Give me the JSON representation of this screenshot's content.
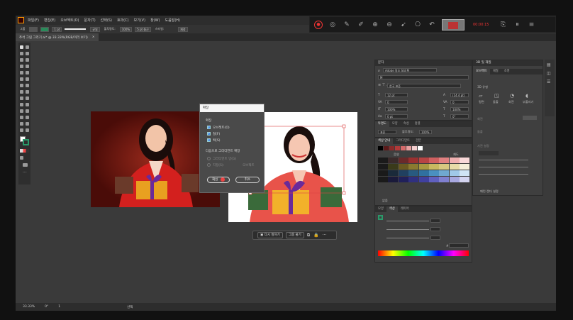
{
  "menu": [
    "파일(F)",
    "편집(E)",
    "오브젝트(O)",
    "문자(T)",
    "선택(S)",
    "효과(C)",
    "보기(V)",
    "창(W)",
    "도움말(H)"
  ],
  "control": {
    "group_label": "그룹",
    "stroke_size": "1 pt",
    "stroke_style": "균일",
    "opacity_label": "불투명도:",
    "opacity_value": "100%",
    "style_label": "스타일:",
    "arrange_label": "재정",
    "ratio": "5 pt 둥근"
  },
  "recorder": {
    "timer": "00:00:15"
  },
  "tab": {
    "title": "추석 그림 그리기.ai* @ 33.33%(RGB/미리 보기)",
    "close": "×"
  },
  "dialog": {
    "title": "확장",
    "section": "확장",
    "options": [
      "오브젝트(O)",
      "칠(F)",
      "획(S)"
    ],
    "gradient_label": "다음으로 그라디언트 확장",
    "gradient_options": [
      "그라디언트 망(G)",
      "지정(S):",
      "오브젝트"
    ],
    "ok": "확인",
    "cancel": "취소"
  },
  "context": {
    "regenerate": "다시 칠하기",
    "group": "그룹 풀기"
  },
  "panels": {
    "char": {
      "title": "문자",
      "font": "Adobe 명조 Std M",
      "style": "M",
      "size": "12 pt",
      "leading": "(14.4 pt)",
      "kerning": "0",
      "tracking": "0",
      "scale_v": "100%",
      "scale_h": "100%",
      "baseline": "0 pt",
      "rotate": "0°",
      "lang": "한국 표준"
    },
    "transparency": {
      "tabs": [
        "투명도",
        "모양",
        "속성",
        "정렬"
      ],
      "mode": "표준",
      "opacity_label": "불투명도:",
      "opacity": "100%"
    },
    "swatch_guide": {
      "tabs": [
        "색상 안내",
        "그라디언트",
        "견본"
      ],
      "left": "음영",
      "right": "채도",
      "footer": "없음"
    },
    "color": {
      "tabs": [
        "모양",
        "색상",
        "레이어"
      ],
      "hex": "#"
    },
    "d3": {
      "title": "3D 및 재질",
      "tabs": [
        "오브젝트",
        "재질",
        "조명"
      ],
      "section": "3D 유형",
      "types": [
        "평면",
        "돌출",
        "회전",
        "부풀리기"
      ],
      "section2": "회전",
      "btn": "돌출",
      "presets": "사전 설정",
      "footer": "패턴 렌더 설정"
    }
  },
  "status": {
    "zoom": "33.33%",
    "angle": "0°",
    "page": "1",
    "mode": "선택"
  },
  "colors": {
    "accent": "#e33",
    "bg": "#3a3a3a"
  },
  "swatches": [
    "#000000",
    "#5a1a1a",
    "#8b2a2a",
    "#b33a3a",
    "#d46a6a",
    "#e8a0a0",
    "#f4d0d0",
    "#ffffff"
  ],
  "guide_rows": [
    [
      "#1a1a1a",
      "#3a2a2a",
      "#6a2a2a",
      "#9a3030",
      "#b84444",
      "#d06060",
      "#e08080",
      "#f0b0b0",
      "#f8d8d8"
    ],
    [
      "#1a1a1a",
      "#3a3a1a",
      "#6a5a20",
      "#8a7a30",
      "#a89a40",
      "#c8b860",
      "#d8c880",
      "#e8dca8",
      "#f4eed8"
    ],
    [
      "#1a1a1a",
      "#1a2a3a",
      "#204060",
      "#285a80",
      "#3070a0",
      "#4a90c0",
      "#70a8d0",
      "#a0c8e8",
      "#d0e4f4"
    ],
    [
      "#1a1a1a",
      "#1a1a3a",
      "#20205a",
      "#303080",
      "#4040a0",
      "#6060c0",
      "#8080d0",
      "#a8a8e0",
      "#d4d4f0"
    ]
  ]
}
